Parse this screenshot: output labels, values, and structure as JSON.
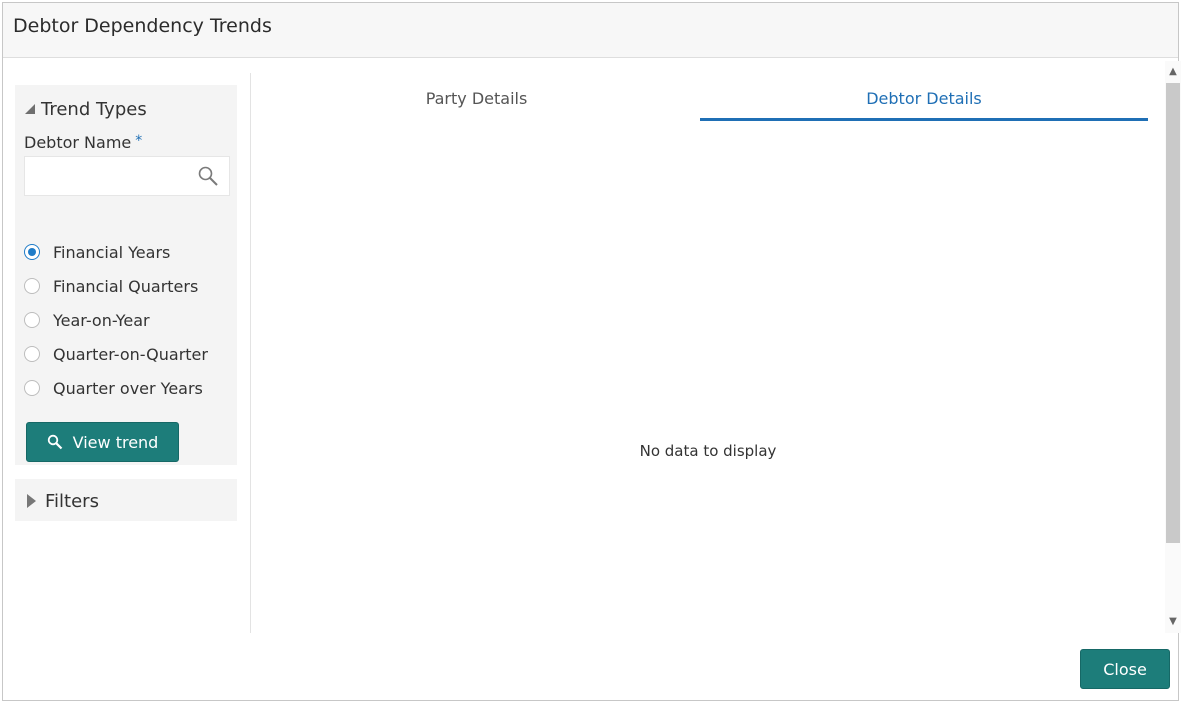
{
  "dialog": {
    "title": "Debtor Dependency Trends"
  },
  "trend_types": {
    "heading": "Trend Types",
    "debtor_name_label": "Debtor Name",
    "required_mark": "*",
    "debtor_name_value": "",
    "options": [
      {
        "label": "Financial Years",
        "checked": true
      },
      {
        "label": "Financial Quarters",
        "checked": false
      },
      {
        "label": "Year-on-Year",
        "checked": false
      },
      {
        "label": "Quarter-on-Quarter",
        "checked": false
      },
      {
        "label": "Quarter over Years",
        "checked": false
      }
    ],
    "view_trend_label": "View trend"
  },
  "filters": {
    "label": "Filters"
  },
  "tabs": [
    {
      "label": "Party Details",
      "active": false
    },
    {
      "label": "Debtor Details",
      "active": true
    }
  ],
  "content": {
    "empty_message": "No data to display"
  },
  "footer": {
    "close_label": "Close"
  },
  "colors": {
    "accent": "#1f6fb5",
    "button": "#1d7d7a"
  },
  "icons": {
    "search": "search-icon",
    "view_trend": "search-icon",
    "collapse": "triangle-down-icon",
    "expand": "triangle-right-icon"
  }
}
